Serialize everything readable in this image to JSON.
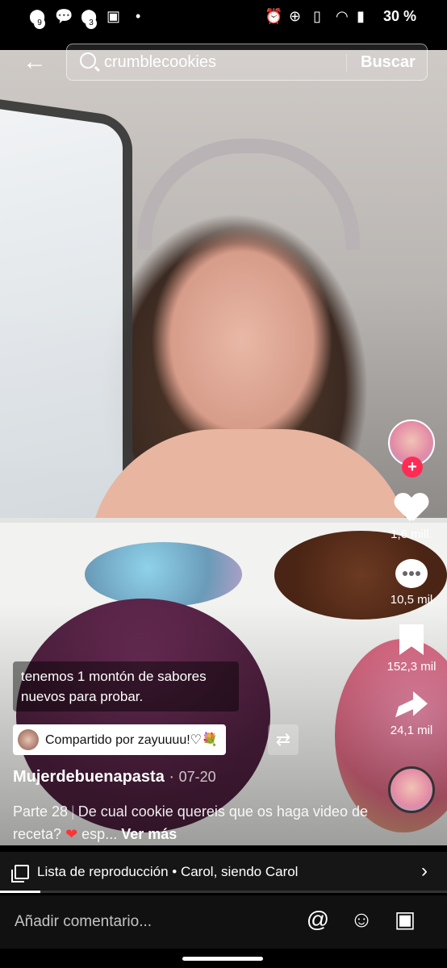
{
  "status_bar": {
    "badge_1": "9",
    "badge_2": "3",
    "dot": "•",
    "battery": "30 %"
  },
  "search": {
    "query": "crumblecookies",
    "button_label": "Buscar"
  },
  "actions": {
    "likes": "1,6 mill.",
    "comments": "10,5 mil",
    "saves": "152,3 mil",
    "shares": "24,1 mil"
  },
  "video": {
    "caption_overlay": "tenemos 1 montón de sabores nuevos para probar.",
    "shared_by": "Compartido por zayuuuu!♡💐",
    "author": "Mujerdebuenapasta",
    "date": "07-20",
    "part": "Parte 28",
    "description": "De cual cookie quereis que os haga video de receta?",
    "description_tail": "esp...",
    "see_more": "Ver más",
    "progress": 0.09
  },
  "playlist": {
    "label": "Lista de reproducción • Carol, siendo Carol"
  },
  "comment": {
    "placeholder": "Añadir comentario..."
  }
}
